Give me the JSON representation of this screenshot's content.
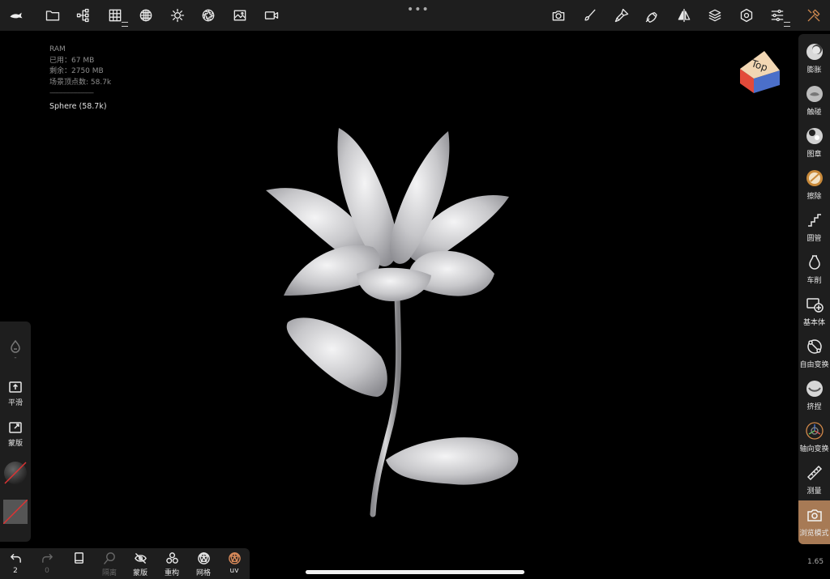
{
  "topbar": {
    "menu_dots": "•••",
    "left_tools": [
      "fish-logo-icon",
      "folder-icon",
      "scene-tree-icon",
      "grid-icon",
      "texture-icon",
      "light-icon",
      "aperture-icon",
      "image-icon",
      "video-icon"
    ],
    "right_tools": [
      "camera-icon",
      "brush-icon",
      "paint-icon",
      "pen-nib-icon",
      "symmetry-icon",
      "layers-icon",
      "settings-icon",
      "sliders-icon",
      "tools-icon"
    ]
  },
  "stats": {
    "title": "RAM",
    "used": "已用：67 MB",
    "remaining": "剩余：2750 MB",
    "vertices": "场景顶点数: 58.7k",
    "separator": "------------------------",
    "object": "Sphere (58.7k)"
  },
  "view_cube": {
    "label": "Top"
  },
  "right_panel": {
    "tools": [
      {
        "id": "inflate",
        "label": "膨胀"
      },
      {
        "id": "smudge",
        "label": "触碰"
      },
      {
        "id": "stamp",
        "label": "图章"
      },
      {
        "id": "erase",
        "label": "擦除"
      },
      {
        "id": "tube",
        "label": "圆管"
      },
      {
        "id": "lathe",
        "label": "车削"
      },
      {
        "id": "primitive",
        "label": "基本体"
      },
      {
        "id": "free-transform",
        "label": "自由变换"
      },
      {
        "id": "pinch",
        "label": "挤捏"
      },
      {
        "id": "axis-transform",
        "label": "轴向变换"
      },
      {
        "id": "measure",
        "label": "测量"
      },
      {
        "id": "view-mode",
        "label": "浏览模式"
      }
    ],
    "zoom": "1.65"
  },
  "left_panel": {
    "dropper_value": "-",
    "smooth_label": "平滑",
    "mask_label": "蒙版"
  },
  "bottom_bar": {
    "undo_count": "2",
    "redo_count": "0",
    "isolate_label": "隔离",
    "mask_label": "蒙版",
    "remesh_label": "重构",
    "mesh_label": "网格",
    "uv_label": "uv"
  },
  "colors": {
    "panel": "#1e1e1e",
    "accent": "#a77a55",
    "uv_icon": "#d98a5a"
  }
}
